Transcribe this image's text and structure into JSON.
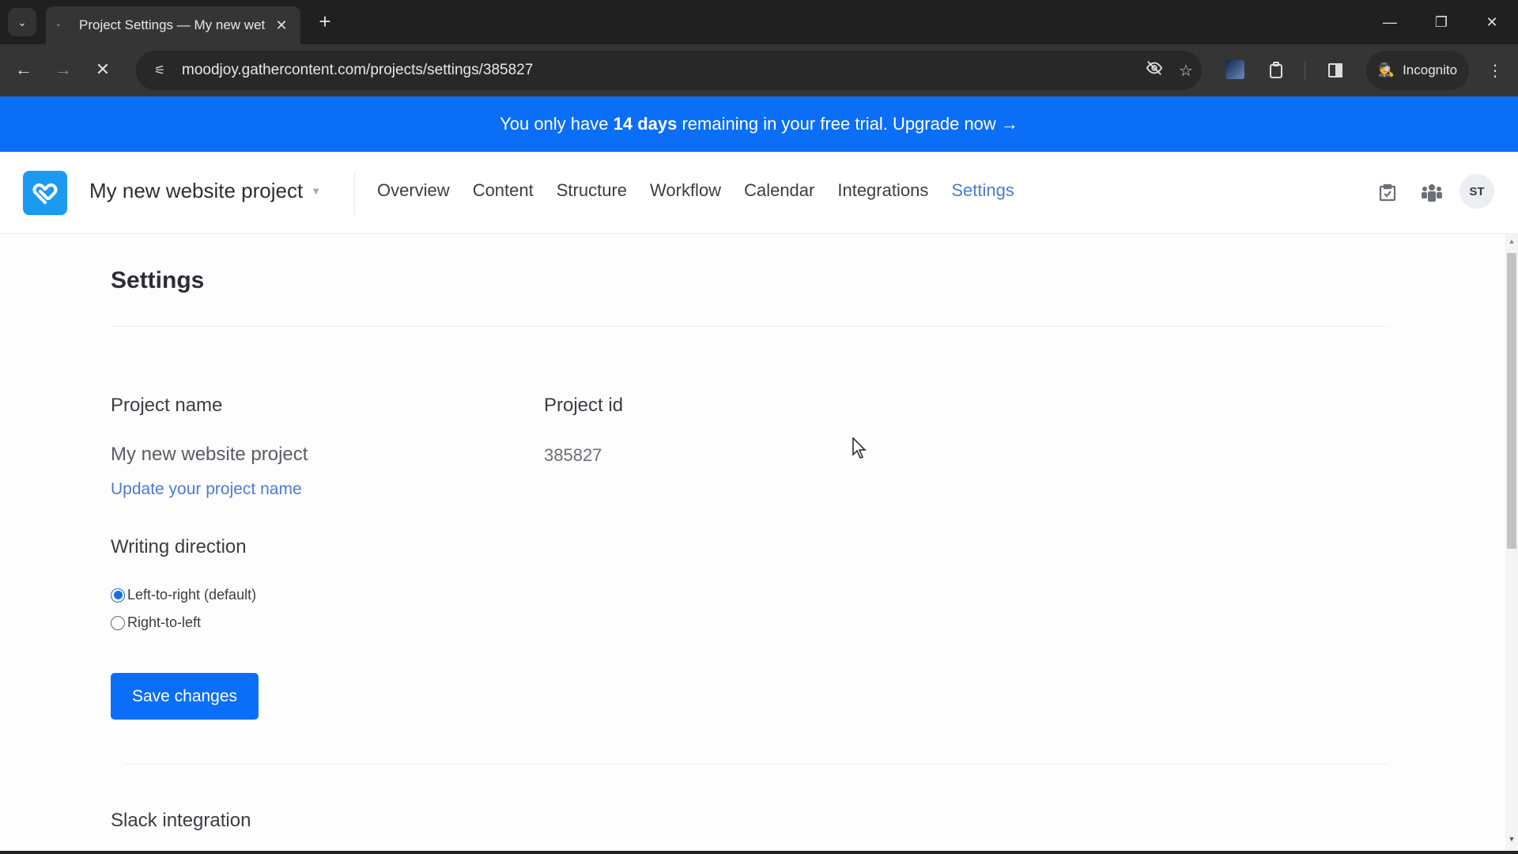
{
  "browser": {
    "tab": {
      "title": "Project Settings — My new wet",
      "close_icon": "close-icon"
    },
    "new_tab_icon": "plus-icon",
    "url": "moodjoy.gathercontent.com/projects/settings/385827",
    "incognito_label": "Incognito",
    "window_controls": {
      "minimize": "—",
      "restore": "❐",
      "close": "✕"
    }
  },
  "banner": {
    "prefix": "You only have",
    "highlight": "14 days",
    "suffix": "remaining in your free trial.",
    "link_label": "Upgrade now →",
    "color": "#0b6ef6"
  },
  "appnav": {
    "project_name": "My new website project",
    "links": [
      {
        "label": "Overview",
        "active": false
      },
      {
        "label": "Content",
        "active": false
      },
      {
        "label": "Structure",
        "active": false
      },
      {
        "label": "Workflow",
        "active": false
      },
      {
        "label": "Calendar",
        "active": false
      },
      {
        "label": "Integrations",
        "active": false
      },
      {
        "label": "Settings",
        "active": true
      }
    ],
    "avatar_initials": "ST",
    "accent_color": "#4a7cd4"
  },
  "main": {
    "title": "Settings",
    "project_name_label": "Project name",
    "project_name_value": "My new website project",
    "update_name_link": "Update your project name",
    "project_id_label": "Project id",
    "project_id_value": "385827",
    "writing_direction": {
      "label": "Writing direction",
      "options": [
        {
          "label": "Left-to-right (default)",
          "checked": true
        },
        {
          "label": "Right-to-left",
          "checked": false
        }
      ]
    },
    "save_button": "Save changes",
    "next_section_title": "Slack integration"
  }
}
